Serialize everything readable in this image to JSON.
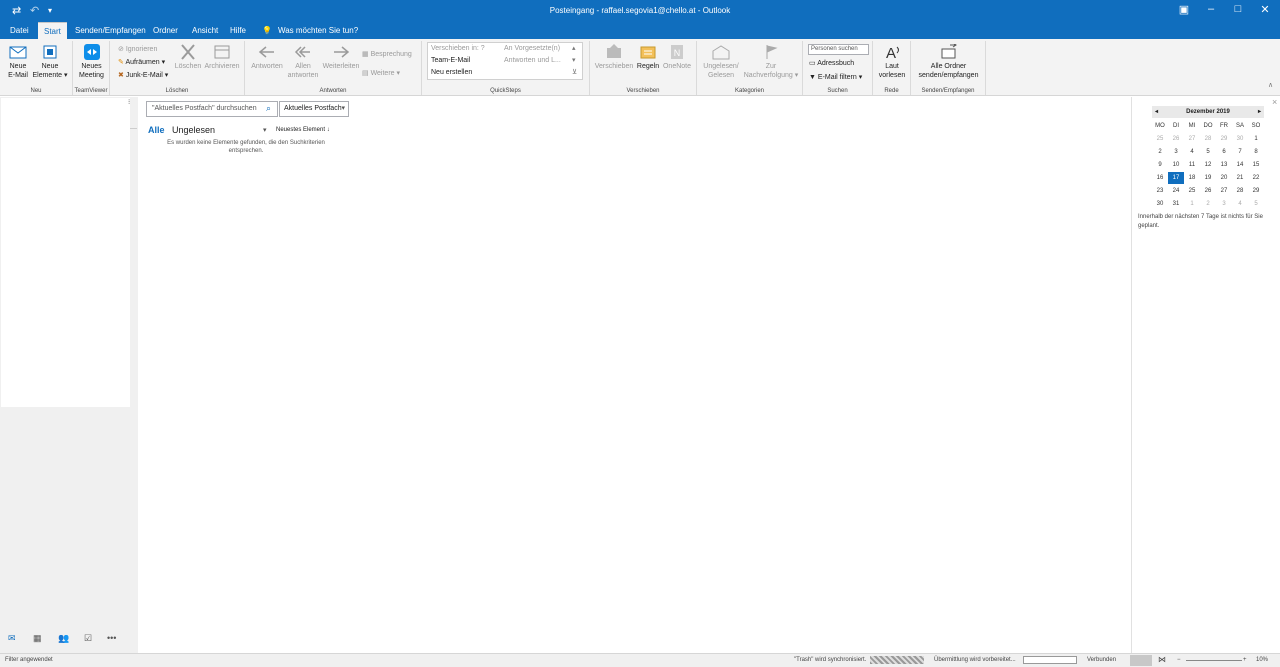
{
  "window": {
    "title": "Posteingang - raffael.segovia1@chello.at - Outlook",
    "controls": [
      "▣",
      "–",
      "□",
      "✕"
    ]
  },
  "tabs": [
    "Datei",
    "Start",
    "Senden/Empfangen",
    "Ordner",
    "Ansicht",
    "Hilfe"
  ],
  "tell_me": "Was möchten Sie tun?",
  "ribbon": {
    "neu": {
      "group": "Neu",
      "new_mail": [
        "Neue",
        "E-Mail"
      ],
      "new_items": [
        "Neue",
        "Elemente ▾"
      ]
    },
    "teamviewer": {
      "group": "TeamViewer",
      "meeting": [
        "Neues",
        "Meeting"
      ]
    },
    "loeschen": {
      "group": "Löschen",
      "ignore": "Ignorieren",
      "cleanup": "Aufräumen ▾",
      "junk": "Junk-E-Mail ▾",
      "delete": "Löschen",
      "archive": "Archivieren"
    },
    "antworten": {
      "group": "Antworten",
      "reply": "Antworten",
      "reply_all": [
        "Allen",
        "antworten"
      ],
      "forward": "Weiterleiten",
      "meeting": "Besprechung",
      "more": "Weitere ▾"
    },
    "quicksteps": {
      "group": "QuickSteps",
      "items": [
        "Verschieben in: ?",
        "An Vorgesetzte(n)",
        "Team-E-Mail",
        "Antworten und L...",
        "Neu erstellen"
      ]
    },
    "verschieben": {
      "group": "Verschieben",
      "move": "Verschieben",
      "rules": "Regeln",
      "onenote": "OneNote"
    },
    "kategorien": {
      "group": "Kategorien",
      "unread": [
        "Ungelesen/",
        "Gelesen"
      ],
      "followup": [
        "Zur",
        "Nachverfolgung ▾"
      ]
    },
    "suchen": {
      "group": "Suchen",
      "people": "Personen suchen",
      "addressbook": "Adressbuch",
      "filter": "E-Mail filtern ▾"
    },
    "rede": {
      "group": "Rede",
      "read": [
        "Laut",
        "vorlesen"
      ]
    },
    "sendrecv": {
      "group": "Senden/Empfangen",
      "all": [
        "Alle Ordner",
        "senden/empfangen"
      ]
    }
  },
  "mail": {
    "search_placeholder": "\"Aktuelles Postfach\" durchsuchen",
    "scope": "Aktuelles Postfach",
    "filter_all": "Alle",
    "filter_unread": "Ungelesen",
    "sort": "Neuestes Element ↓",
    "empty": [
      "Es wurden keine Elemente gefunden, die den Suchkriterien",
      "entsprechen."
    ]
  },
  "calendar": {
    "month": "Dezember 2019",
    "weekdays": [
      "MO",
      "DI",
      "MI",
      "DO",
      "FR",
      "SA",
      "SO"
    ],
    "days": [
      "25",
      "26",
      "27",
      "28",
      "29",
      "30",
      "1",
      "2",
      "3",
      "4",
      "5",
      "6",
      "7",
      "8",
      "9",
      "10",
      "11",
      "12",
      "13",
      "14",
      "15",
      "16",
      "17",
      "18",
      "19",
      "20",
      "21",
      "22",
      "23",
      "24",
      "25",
      "26",
      "27",
      "28",
      "29",
      "30",
      "31",
      "1",
      "2",
      "3",
      "4",
      "5"
    ],
    "today": "17",
    "note": "Innerhalb der nächsten 7 Tage ist nichts für Sie geplant."
  },
  "status": {
    "filter": "Filter angewendet",
    "sync": "\"Trash\" wird synchronisiert.",
    "transfer": "Übermittlung wird vorbereitet...",
    "connected": "Verbunden",
    "zoom": "10%"
  },
  "colors": {
    "accent": "#106ebe",
    "ribbon": "#f3f3f3"
  }
}
